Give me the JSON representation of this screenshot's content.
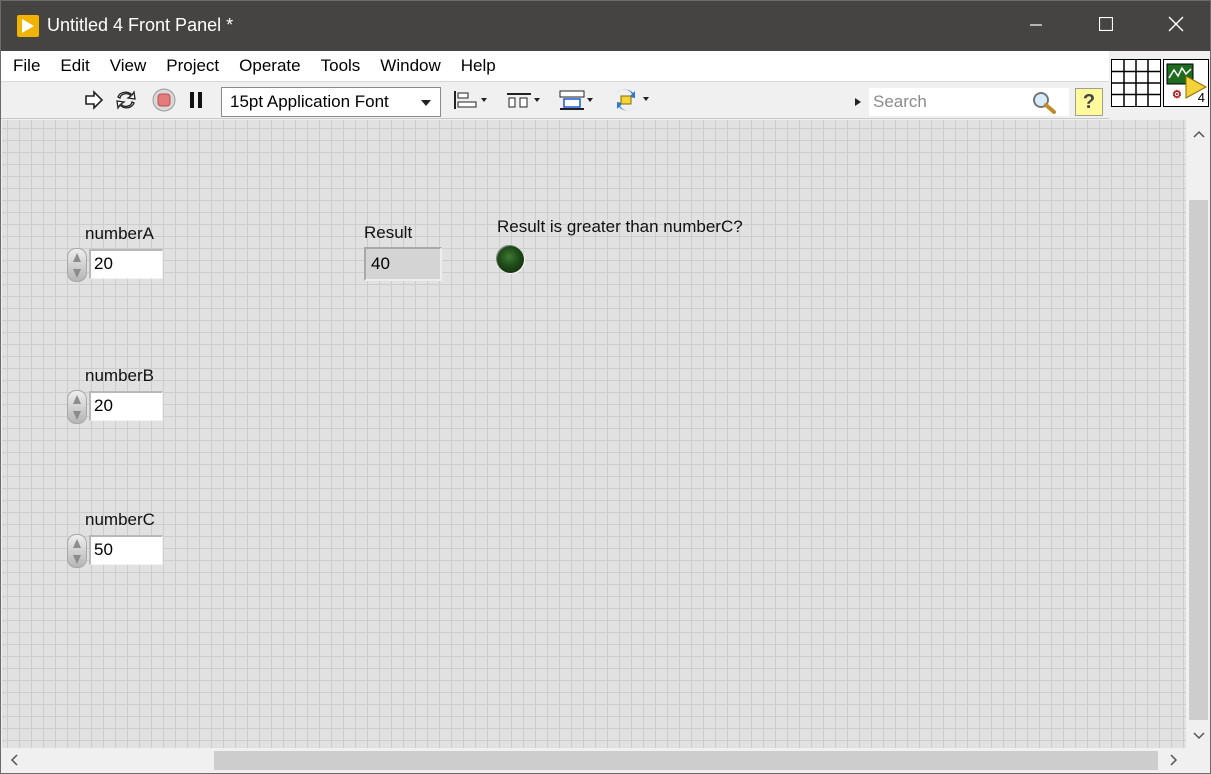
{
  "window": {
    "title": "Untitled 4 Front Panel *",
    "controls": {
      "minimize_icon": "minimize-icon",
      "maximize_icon": "maximize-icon",
      "close_icon": "close-icon"
    }
  },
  "menu": [
    "File",
    "Edit",
    "View",
    "Project",
    "Operate",
    "Tools",
    "Window",
    "Help"
  ],
  "toolbar": {
    "run_icon": "run-arrow-icon",
    "run_continuously_icon": "run-continuously-icon",
    "abort_icon": "abort-stop-icon",
    "pause_icon": "pause-icon",
    "font": "15pt Application Font",
    "align_icon": "align-objects-icon",
    "distribute_icon": "distribute-objects-icon",
    "resize_icon": "resize-objects-icon",
    "reorder_icon": "reorder-icon",
    "search_placeholder": "Search",
    "search_icon": "magnifier-icon",
    "help_label": "?"
  },
  "connector": {
    "icon_number": "4"
  },
  "panel": {
    "controls": [
      {
        "label": "numberA",
        "value": "20"
      },
      {
        "label": "numberB",
        "value": "20"
      },
      {
        "label": "numberC",
        "value": "50"
      }
    ],
    "result": {
      "label": "Result",
      "value": "40"
    },
    "boolean": {
      "label": "Result is greater than numberC?",
      "state": "off",
      "color_off": "#1e4a18"
    }
  },
  "colors": {
    "titlebar": "#464442",
    "panel_bg": "#e1e1e1",
    "grid": "#cdcdcd",
    "app_icon": "#f0b400"
  }
}
